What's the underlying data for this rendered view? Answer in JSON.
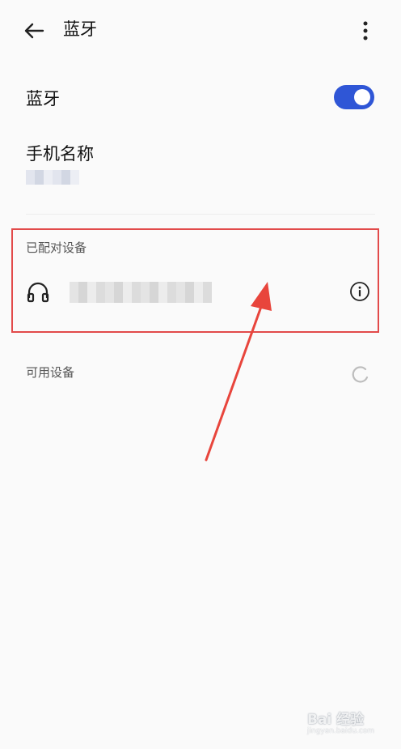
{
  "header": {
    "title": "蓝牙"
  },
  "bluetooth": {
    "label": "蓝牙",
    "enabled": true,
    "toggle_color": "#2f56d6"
  },
  "device_name": {
    "label": "手机名称",
    "value": "▒▒▒▒▒▒"
  },
  "paired": {
    "header": "已配对设备",
    "devices": [
      {
        "name": "▒▒▒▒▒▒▒▒▒▒▒▒▒▒▒▒",
        "icon": "headphones-icon"
      }
    ]
  },
  "available": {
    "header": "可用设备",
    "loading": true
  },
  "annotation": {
    "highlight_color": "#e24a4a"
  },
  "watermark": {
    "brand": "Bai 经验",
    "url": "jingyan.baidu.com"
  }
}
